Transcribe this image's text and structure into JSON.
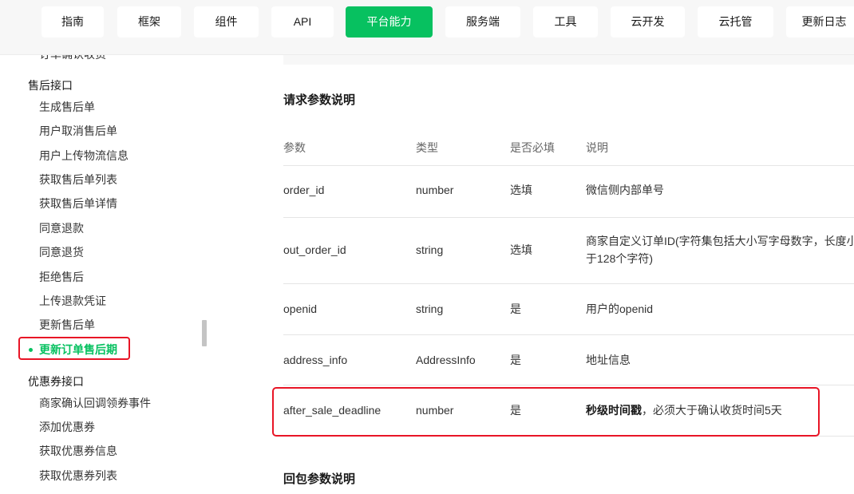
{
  "nav": {
    "tabs": [
      {
        "label": "指南",
        "active": false
      },
      {
        "label": "框架",
        "active": false
      },
      {
        "label": "组件",
        "active": false
      },
      {
        "label": "API",
        "active": false
      },
      {
        "label": "平台能力",
        "active": true
      },
      {
        "label": "服务端",
        "active": false
      },
      {
        "label": "工具",
        "active": false
      },
      {
        "label": "云开发",
        "active": false
      },
      {
        "label": "云托管",
        "active": false
      },
      {
        "label": "更新日志",
        "active": false
      }
    ]
  },
  "sidebar": {
    "cut_item": "订单确认收货",
    "groups": [
      {
        "label": "售后接口",
        "items": [
          {
            "label": "生成售后单"
          },
          {
            "label": "用户取消售后单"
          },
          {
            "label": "用户上传物流信息"
          },
          {
            "label": "获取售后单列表"
          },
          {
            "label": "获取售后单详情"
          },
          {
            "label": "同意退款"
          },
          {
            "label": "同意退货"
          },
          {
            "label": "拒绝售后"
          },
          {
            "label": "上传退款凭证"
          },
          {
            "label": "更新售后单"
          },
          {
            "label": "更新订单售后期",
            "active": true
          }
        ]
      },
      {
        "label": "优惠券接口",
        "items": [
          {
            "label": "商家确认回调领券事件"
          },
          {
            "label": "添加优惠券"
          },
          {
            "label": "获取优惠券信息"
          },
          {
            "label": "获取优惠券列表"
          }
        ]
      }
    ]
  },
  "main": {
    "request_title": "请求参数说明",
    "response_title": "回包参数说明",
    "table": {
      "headers": [
        "参数",
        "类型",
        "是否必填",
        "说明"
      ],
      "rows": [
        {
          "param": "order_id",
          "type": "number",
          "required": "选填",
          "desc": "微信侧内部单号"
        },
        {
          "param": "out_order_id",
          "type": "string",
          "required": "选填",
          "desc_line1": "商家自定义订单ID(字符集包括大小写字母数字，长度小",
          "desc_line2": "于128个字符)"
        },
        {
          "param": "openid",
          "type": "string",
          "required": "是",
          "desc": "用户的openid"
        },
        {
          "param": "address_info",
          "type": "AddressInfo",
          "required": "是",
          "desc": "地址信息"
        },
        {
          "param": "after_sale_deadline",
          "type": "number",
          "required": "是",
          "desc_strong": "秒级时间戳",
          "desc_rest": "，必须大于确认收货时间5天"
        }
      ]
    }
  },
  "colors": {
    "brand_green": "#07c160",
    "highlight_red": "#e81526"
  }
}
